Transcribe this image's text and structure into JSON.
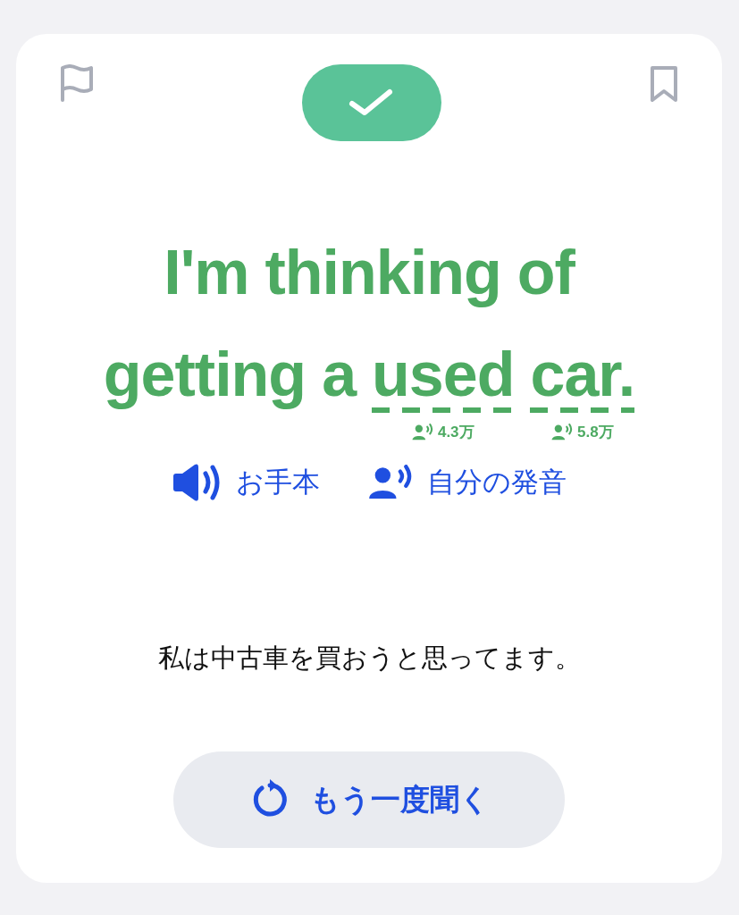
{
  "card": {
    "flagged": false,
    "bookmarked": false,
    "correct": true,
    "sentence": {
      "lines": [
        [
          {
            "text": "I'm",
            "underlined": false
          },
          {
            "text": "thinking",
            "underlined": false
          },
          {
            "text": "of",
            "underlined": false
          }
        ],
        [
          {
            "text": "getting",
            "underlined": false
          },
          {
            "text": "a",
            "underlined": false
          },
          {
            "text": "used",
            "underlined": true,
            "count": "4.3万"
          },
          {
            "text": "car.",
            "underlined": true,
            "count": "5.8万"
          }
        ]
      ]
    },
    "audio_buttons": [
      {
        "kind": "model",
        "label": "お手本"
      },
      {
        "kind": "mine",
        "label": "自分の発音"
      }
    ],
    "translation": "私は中古車を買おうと思ってます。",
    "replay_button": {
      "label": "もう一度聞く"
    }
  }
}
